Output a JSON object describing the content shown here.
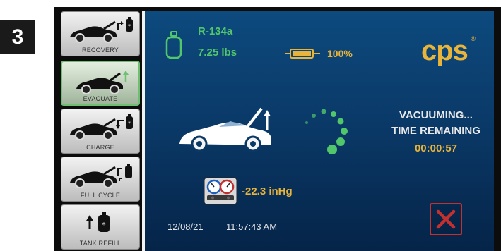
{
  "step_number": "3",
  "sidebar": {
    "items": [
      {
        "label": "RECOVERY",
        "icon": "car-recovery-icon"
      },
      {
        "label": "EVACUATE",
        "icon": "car-evacuate-icon",
        "active": true
      },
      {
        "label": "CHARGE",
        "icon": "car-charge-icon"
      },
      {
        "label": "FULL CYCLE",
        "icon": "car-full-cycle-icon"
      },
      {
        "label": "TANK REFILL",
        "icon": "tank-refill-icon"
      }
    ]
  },
  "refrigerant": {
    "name": "R-134a",
    "weight": "7.25 lbs",
    "icon": "gas-cylinder-icon"
  },
  "battery": {
    "percent": "100%",
    "icon": "battery-icon"
  },
  "brand": {
    "logo_text": "cps",
    "mark": "®"
  },
  "status": {
    "line1": "VACUUMING...",
    "line2": "TIME REMAINING",
    "timer": "00:00:57"
  },
  "pressure": {
    "value": "-22.3 inHg",
    "icon": "manifold-gauge-icon"
  },
  "datetime": {
    "date": "12/08/21",
    "time": "11:57:43 AM"
  },
  "colors": {
    "accent_green": "#52c66a",
    "accent_amber": "#e8b43a",
    "cancel_red": "#c33030",
    "screen_blue": "#0a3866"
  }
}
